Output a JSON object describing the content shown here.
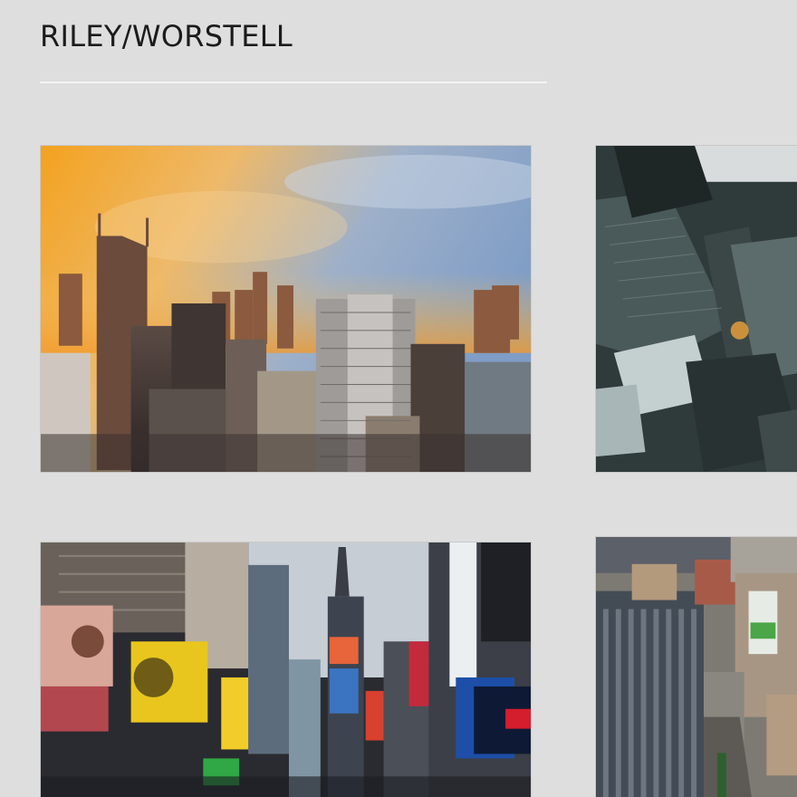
{
  "site": {
    "title": "RILEY/WORSTELL"
  },
  "gallery": {
    "items": [
      {
        "subject": "sunset-city-skyline"
      },
      {
        "subject": "aerial-skyscrapers"
      },
      {
        "subject": "times-square-billboards"
      },
      {
        "subject": "aerial-city-street"
      }
    ]
  },
  "colors": {
    "background": "#dedede",
    "title_text": "#1b1b1b",
    "rule": "#f4f4f4"
  }
}
